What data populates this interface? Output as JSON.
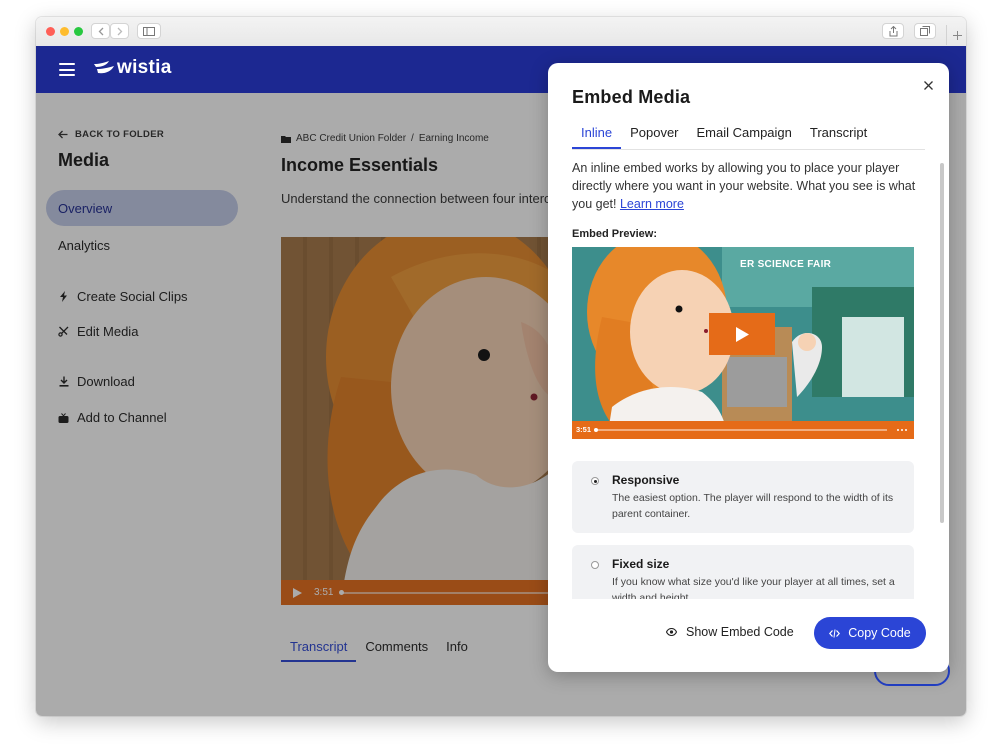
{
  "browser": {
    "traffic_lights": [
      "#ff5f57",
      "#febc2e",
      "#28c840"
    ]
  },
  "app": {
    "brand": "wistia",
    "brand_color": "#1c2891"
  },
  "sidebar": {
    "back_label": "BACK TO FOLDER",
    "title": "Media",
    "nav": [
      {
        "label": "Overview",
        "active": true
      },
      {
        "label": "Analytics",
        "active": false
      }
    ],
    "actions": [
      {
        "label": "Create Social Clips",
        "icon": "bolt-icon"
      },
      {
        "label": "Edit Media",
        "icon": "scissors-icon"
      },
      {
        "label": "Download",
        "icon": "download-icon"
      },
      {
        "label": "Add to Channel",
        "icon": "channel-icon"
      }
    ]
  },
  "main": {
    "breadcrumb_folder": "ABC Credit Union Folder",
    "breadcrumb_separator": "/",
    "breadcrumb_current": "Earning Income",
    "title": "Income Essentials",
    "description": "Understand the connection between four interc",
    "video_time": "3:51",
    "tabs": [
      {
        "label": "Transcript",
        "active": true
      },
      {
        "label": "Comments",
        "active": false
      },
      {
        "label": "Info",
        "active": false
      }
    ]
  },
  "modal": {
    "title": "Embed Media",
    "tabs": [
      {
        "label": "Inline",
        "active": true
      },
      {
        "label": "Popover",
        "active": false
      },
      {
        "label": "Email Campaign",
        "active": false
      },
      {
        "label": "Transcript",
        "active": false
      }
    ],
    "intro": "An inline embed works by allowing you to place your player directly where you want in your website. What you see is what you get!",
    "learn_more": "Learn more",
    "preview_label": "Embed Preview:",
    "preview_banner": "ER SCIENCE FAIR",
    "preview_time": "3:51",
    "options": [
      {
        "title": "Responsive",
        "desc": "The easiest option. The player will respond to the width of its parent container.",
        "selected": true
      },
      {
        "title": "Fixed size",
        "desc": "If you know what size you'd like your player at all times, set a width and height.",
        "selected": false
      }
    ],
    "show_embed_code": "Show Embed Code",
    "copy_code": "Copy Code",
    "accent": "#2b45d6"
  }
}
